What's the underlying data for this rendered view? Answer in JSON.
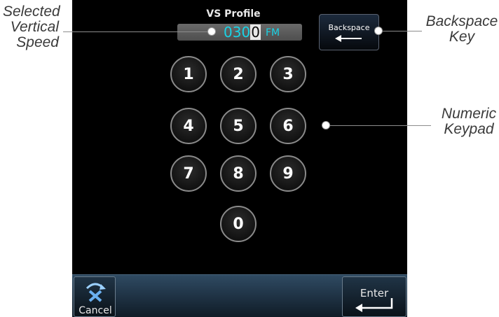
{
  "callouts": {
    "selected_vs": [
      "Selected",
      "Vertical",
      "Speed"
    ],
    "backspace_key": [
      "Backspace",
      "Key"
    ],
    "numeric_keypad": [
      "Numeric",
      "Keypad"
    ]
  },
  "screen": {
    "title": "VS Profile",
    "vs_value_before_cursor": "030",
    "vs_value_cursor_digit": "0",
    "vs_unit": "FM",
    "backspace_label": "Backspace",
    "keypad": [
      "1",
      "2",
      "3",
      "4",
      "5",
      "6",
      "7",
      "8",
      "9",
      "0"
    ],
    "cancel_label": "Cancel",
    "enter_label": "Enter"
  },
  "icons": {
    "backspace": "left-arrow-icon",
    "cancel": "cancel-x-icon",
    "enter": "enter-return-icon"
  },
  "colors": {
    "screen_bg": "#000000",
    "value_cyan": "#19d3e6",
    "bar_blue": "#2f4a62"
  }
}
